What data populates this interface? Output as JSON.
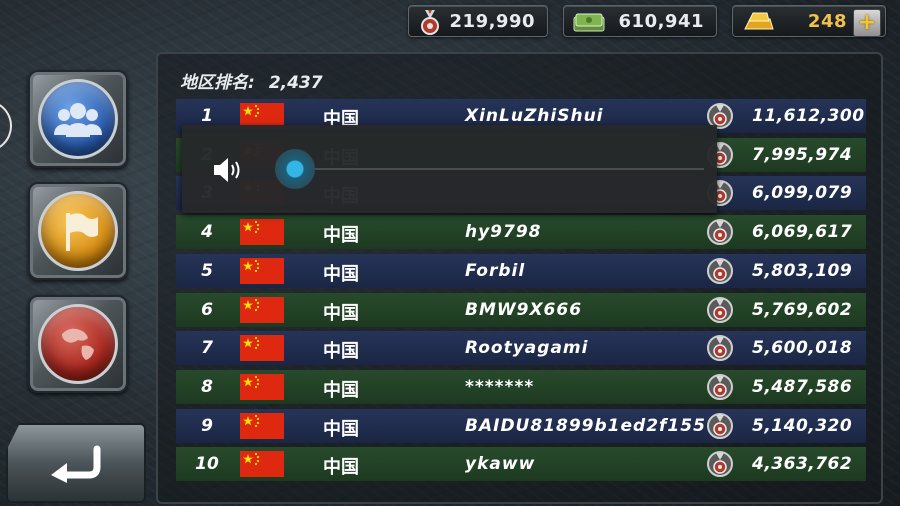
{
  "header": {
    "medals_value": "219,990",
    "cash_value": "610,941",
    "gold_value": "248",
    "icons": [
      "medal-icon",
      "cash-icon",
      "gold-bar-icon",
      "plus-icon"
    ]
  },
  "sidebar": {
    "buttons": [
      "friends-button",
      "flag-button",
      "globe-button",
      "back-button"
    ]
  },
  "leaderboard": {
    "region_rank_label": "地区排名:",
    "region_rank_value": "2,437",
    "rows": [
      {
        "rank": "1",
        "country": "中国",
        "name": "XinLuZhiShui",
        "score": "11,612,300",
        "row_color": "blue"
      },
      {
        "rank": "2",
        "country": "中国",
        "name": "",
        "score": "7,995,974",
        "row_color": "green"
      },
      {
        "rank": "3",
        "country": "中国",
        "name": "",
        "score": "6,099,079",
        "row_color": "blue"
      },
      {
        "rank": "4",
        "country": "中国",
        "name": "hy9798",
        "score": "6,069,617",
        "row_color": "green"
      },
      {
        "rank": "5",
        "country": "中国",
        "name": "Forbil",
        "score": "5,803,109",
        "row_color": "blue"
      },
      {
        "rank": "6",
        "country": "中国",
        "name": "BMW9X666",
        "score": "5,769,602",
        "row_color": "green"
      },
      {
        "rank": "7",
        "country": "中国",
        "name": "Rootyagami",
        "score": "5,600,018",
        "row_color": "blue"
      },
      {
        "rank": "8",
        "country": "中国",
        "name": "*******",
        "score": "5,487,586",
        "row_color": "green"
      },
      {
        "rank": "9",
        "country": "中国",
        "name": "BAIDU81899b1ed2f155",
        "score": "5,140,320",
        "row_color": "blue"
      },
      {
        "rank": "10",
        "country": "中国",
        "name": "ykaww",
        "score": "4,363,762",
        "row_color": "green"
      }
    ]
  },
  "volume_overlay": {
    "level": 0.0,
    "icons": [
      "speaker-icon"
    ]
  },
  "colors": {
    "gold_text": "#f2c14a",
    "row_blue": "#263458",
    "row_green": "#284a2c",
    "volume_accent": "#33b5e5"
  }
}
